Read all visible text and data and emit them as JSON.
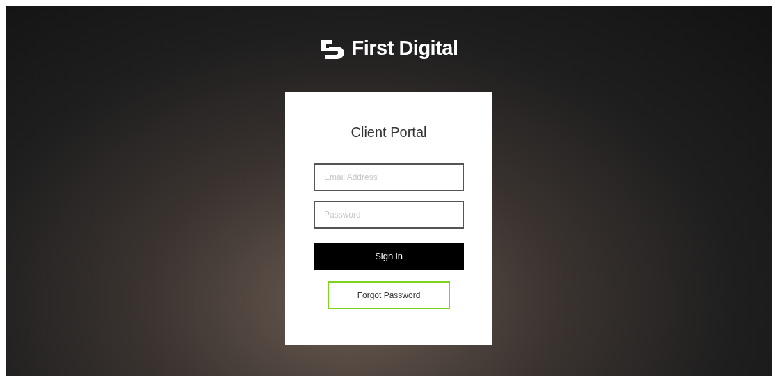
{
  "brand": {
    "name": "First Digital"
  },
  "login": {
    "title": "Client Portal",
    "fields": [
      {
        "placeholder": "Email Address"
      },
      {
        "placeholder": "Password"
      }
    ],
    "sign_in_button": {
      "label": "Sign in"
    },
    "forgot_link": {
      "label": "Forgot Password",
      "focused": true
    }
  }
}
